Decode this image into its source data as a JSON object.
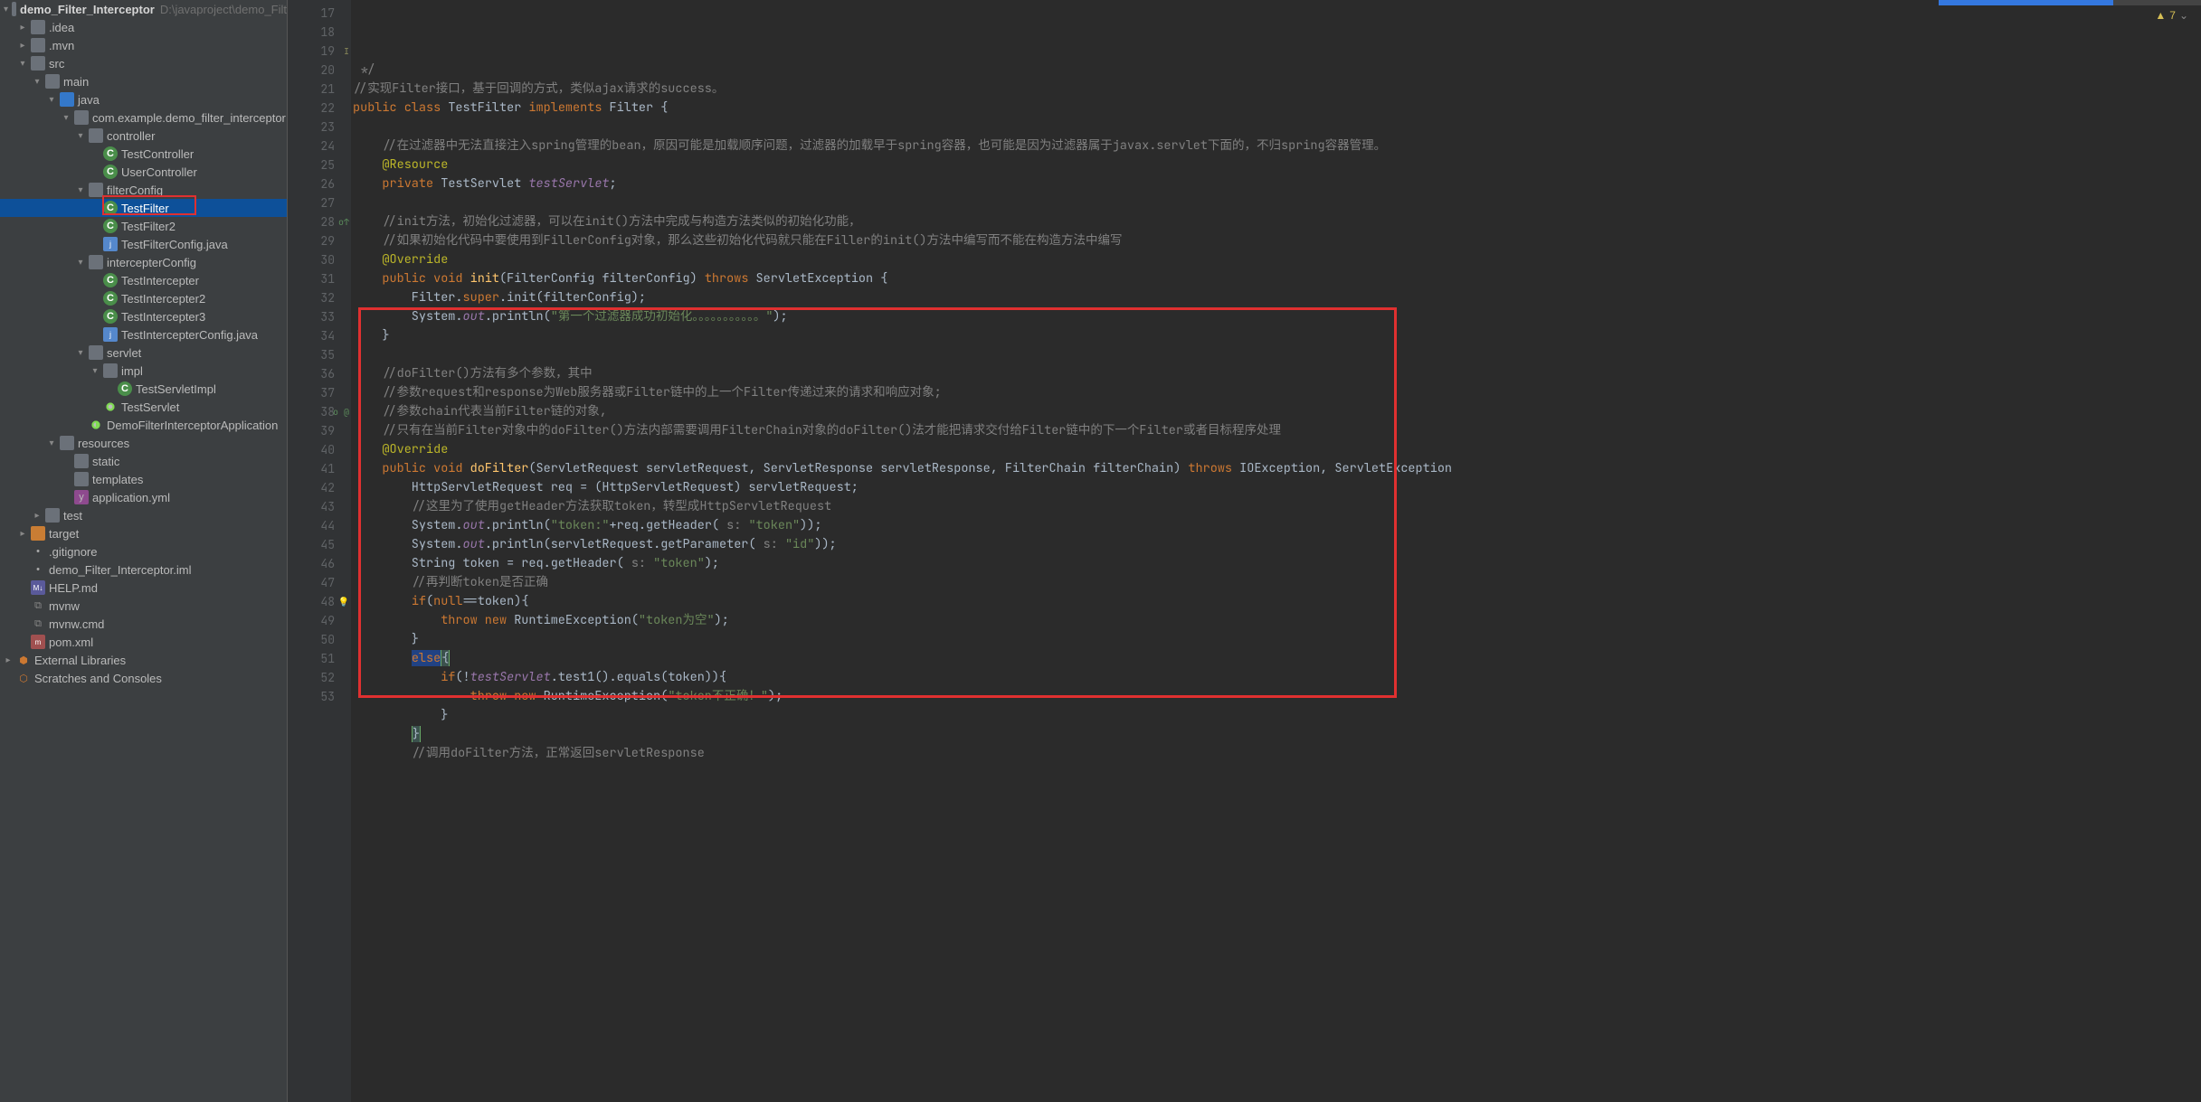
{
  "warnings": {
    "count": "7"
  },
  "project": {
    "name": "demo_Filter_Interceptor",
    "path": "D:\\javaproject\\demo_Filt"
  },
  "tree": [
    {
      "indent": 0,
      "arrow": "▾",
      "icon": "folder",
      "iconClass": "folder",
      "label": "demo_Filter_Interceptor",
      "bold": true,
      "extra": "D:\\javaproject\\demo_Filt"
    },
    {
      "indent": 1,
      "arrow": "▸",
      "icon": "folder",
      "iconClass": "folder",
      "label": ".idea"
    },
    {
      "indent": 1,
      "arrow": "▸",
      "icon": "folder",
      "iconClass": "folder",
      "label": ".mvn"
    },
    {
      "indent": 1,
      "arrow": "▾",
      "icon": "folder",
      "iconClass": "folder",
      "label": "src"
    },
    {
      "indent": 2,
      "arrow": "▾",
      "icon": "folder",
      "iconClass": "folder",
      "label": "main"
    },
    {
      "indent": 3,
      "arrow": "▾",
      "icon": "folder",
      "iconClass": "folder-blue",
      "label": "java"
    },
    {
      "indent": 4,
      "arrow": "▾",
      "icon": "folder",
      "iconClass": "folder",
      "label": "com.example.demo_filter_interceptor"
    },
    {
      "indent": 5,
      "arrow": "▾",
      "icon": "folder",
      "iconClass": "folder",
      "label": "controller"
    },
    {
      "indent": 6,
      "arrow": "",
      "icon": "C",
      "iconClass": "class",
      "label": "TestController"
    },
    {
      "indent": 6,
      "arrow": "",
      "icon": "C",
      "iconClass": "class",
      "label": "UserController"
    },
    {
      "indent": 5,
      "arrow": "▾",
      "icon": "folder",
      "iconClass": "folder",
      "label": "filterConfig"
    },
    {
      "indent": 6,
      "arrow": "",
      "icon": "C",
      "iconClass": "class",
      "label": "TestFilter",
      "selected": true,
      "boxed": true
    },
    {
      "indent": 6,
      "arrow": "",
      "icon": "C",
      "iconClass": "class",
      "label": "TestFilter2"
    },
    {
      "indent": 6,
      "arrow": "",
      "icon": "j",
      "iconClass": "config",
      "label": "TestFilterConfig.java"
    },
    {
      "indent": 5,
      "arrow": "▾",
      "icon": "folder",
      "iconClass": "folder",
      "label": "intercepterConfig"
    },
    {
      "indent": 6,
      "arrow": "",
      "icon": "C",
      "iconClass": "class",
      "label": "TestIntercepter"
    },
    {
      "indent": 6,
      "arrow": "",
      "icon": "C",
      "iconClass": "class",
      "label": "TestIntercepter2"
    },
    {
      "indent": 6,
      "arrow": "",
      "icon": "C",
      "iconClass": "class",
      "label": "TestIntercepter3"
    },
    {
      "indent": 6,
      "arrow": "",
      "icon": "j",
      "iconClass": "config",
      "label": "TestIntercepterConfig.java"
    },
    {
      "indent": 5,
      "arrow": "▾",
      "icon": "folder",
      "iconClass": "folder",
      "label": "servlet"
    },
    {
      "indent": 6,
      "arrow": "▾",
      "icon": "folder",
      "iconClass": "folder",
      "label": "impl"
    },
    {
      "indent": 7,
      "arrow": "",
      "icon": "C",
      "iconClass": "class",
      "label": "TestServletImpl"
    },
    {
      "indent": 6,
      "arrow": "",
      "icon": "●",
      "iconClass": "app",
      "label": "TestServlet"
    },
    {
      "indent": 5,
      "arrow": "",
      "icon": "◐",
      "iconClass": "app",
      "label": "DemoFilterInterceptorApplication"
    },
    {
      "indent": 3,
      "arrow": "▾",
      "icon": "folder",
      "iconClass": "folder",
      "label": "resources"
    },
    {
      "indent": 4,
      "arrow": "",
      "icon": "folder",
      "iconClass": "folder",
      "label": "static"
    },
    {
      "indent": 4,
      "arrow": "",
      "icon": "folder",
      "iconClass": "folder",
      "label": "templates"
    },
    {
      "indent": 4,
      "arrow": "",
      "icon": "y",
      "iconClass": "yml",
      "label": "application.yml"
    },
    {
      "indent": 2,
      "arrow": "▸",
      "icon": "folder",
      "iconClass": "folder",
      "label": "test"
    },
    {
      "indent": 1,
      "arrow": "▸",
      "icon": "folder",
      "iconClass": "folder-orange",
      "label": "target"
    },
    {
      "indent": 1,
      "arrow": "",
      "icon": "•",
      "iconClass": "txt",
      "label": ".gitignore"
    },
    {
      "indent": 1,
      "arrow": "",
      "icon": "•",
      "iconClass": "txt",
      "label": "demo_Filter_Interceptor.iml"
    },
    {
      "indent": 1,
      "arrow": "",
      "icon": "M↓",
      "iconClass": "md",
      "label": "HELP.md"
    },
    {
      "indent": 1,
      "arrow": "",
      "icon": "⧉",
      "iconClass": "cmd",
      "label": "mvnw"
    },
    {
      "indent": 1,
      "arrow": "",
      "icon": "⧉",
      "iconClass": "cmd",
      "label": "mvnw.cmd"
    },
    {
      "indent": 1,
      "arrow": "",
      "icon": "m",
      "iconClass": "xml",
      "label": "pom.xml"
    },
    {
      "indent": 0,
      "arrow": "▸",
      "icon": "⬢",
      "iconClass": "ext",
      "label": "External Libraries"
    },
    {
      "indent": 0,
      "arrow": "",
      "icon": "⬡",
      "iconClass": "scr",
      "label": "Scratches and Consoles"
    }
  ],
  "gutter": {
    "start": 17,
    "end": 53,
    "marks": {
      "19": "i",
      "28": "o↑",
      "38": "o↑ @",
      "48": "bulb"
    }
  },
  "codeLines": [
    {
      "n": 17,
      "html": " <span class='com'>*/</span>"
    },
    {
      "n": 18,
      "html": "<span class='com'>//实现Filter接口，基于回调的方式，类似ajax请求的success。</span>"
    },
    {
      "n": 19,
      "html": "<span class='kw'>public class </span><span class='typ'>TestFilter </span><span class='kw'>implements </span><span class='typ'>Filter </span>{"
    },
    {
      "n": 20,
      "html": ""
    },
    {
      "n": 21,
      "html": "    <span class='com'>//在过滤器中无法直接注入spring管理的bean，原因可能是加载顺序问题，过滤器的加载早于spring容器，也可能是因为过滤器属于javax.servlet下面的，不归spring容器管理。</span>"
    },
    {
      "n": 22,
      "html": "    <span class='ann'>@Resource</span>"
    },
    {
      "n": 23,
      "html": "    <span class='kw'>private </span><span class='typ'>TestServlet </span><span class='fld'>testServlet</span>;"
    },
    {
      "n": 24,
      "html": ""
    },
    {
      "n": 25,
      "html": "    <span class='com'>//init方法，初始化过滤器，可以在init()方法中完成与构造方法类似的初始化功能，</span>"
    },
    {
      "n": 26,
      "html": "    <span class='com'>//如果初始化代码中要使用到FillerConfig对象，那么这些初始化代码就只能在Filler的init()方法中编写而不能在构造方法中编写</span>"
    },
    {
      "n": 27,
      "html": "    <span class='ann'>@Override</span>"
    },
    {
      "n": 28,
      "html": "    <span class='kw'>public void </span><span class='met'>init</span>(FilterConfig filterConfig) <span class='kw'>throws </span>ServletException {"
    },
    {
      "n": 29,
      "html": "        Filter.<span class='kw'>super</span>.init(filterConfig);"
    },
    {
      "n": 30,
      "html": "        System.<span class='fld'>out</span>.println(<span class='str'>\"第一个过滤器成功初始化。。。。。。。。。。。\"</span>);"
    },
    {
      "n": 31,
      "html": "    }"
    },
    {
      "n": 32,
      "html": ""
    },
    {
      "n": 33,
      "html": "    <span class='com'>//doFilter()方法有多个参数，其中</span>"
    },
    {
      "n": 34,
      "html": "    <span class='com'>//参数request和response为Web服务器或Filter链中的上一个Filter传递过来的请求和响应对象;</span>"
    },
    {
      "n": 35,
      "html": "    <span class='com'>//参数chain代表当前Filter链的对象,</span>"
    },
    {
      "n": 36,
      "html": "    <span class='com'>//只有在当前Filter对象中的doFilter()方法内部需要调用FilterChain对象的doFilter()法才能把请求交付给Filter链中的下一个Filter或者目标程序处理</span>"
    },
    {
      "n": 37,
      "html": "    <span class='ann'>@Override</span>"
    },
    {
      "n": 38,
      "html": "    <span class='kw'>public void </span><span class='met'>doFilter</span>(ServletRequest servletRequest, ServletResponse servletResponse, FilterChain filterChain) <span class='kw'>throws </span>IOException, ServletException "
    },
    {
      "n": 39,
      "html": "        HttpServletRequest req = (HttpServletRequest) servletRequest;"
    },
    {
      "n": 40,
      "html": "        <span class='com'>//这里为了使用getHeader方法获取token，转型成HttpServletRequest</span>"
    },
    {
      "n": 41,
      "html": "        System.<span class='fld'>out</span>.println(<span class='str'>\"token:\"</span>+req.getHeader( <span class='com'>s:</span> <span class='str'>\"token\"</span>));"
    },
    {
      "n": 42,
      "html": "        System.<span class='fld'>out</span>.println(servletRequest.getParameter( <span class='com'>s:</span> <span class='str'>\"id\"</span>));"
    },
    {
      "n": 43,
      "html": "        String token = req.getHeader( <span class='com'>s:</span> <span class='str'>\"token\"</span>);"
    },
    {
      "n": 44,
      "html": "        <span class='com'>//再判断token是否正确</span>"
    },
    {
      "n": 45,
      "html": "        <span class='kw'>if</span>(<span class='kw'>null</span>==token){"
    },
    {
      "n": 46,
      "html": "            <span class='kw'>throw new </span>RuntimeException(<span class='str'>\"token为空\"</span>);"
    },
    {
      "n": 47,
      "html": "        }"
    },
    {
      "n": 48,
      "html": "        <span class='kw hl-else'>else</span><span class='hl-brace'>{</span>"
    },
    {
      "n": 49,
      "html": "            <span class='kw'>if</span>(!<span class='fld'>testServlet</span>.test1().equals(token)){"
    },
    {
      "n": 50,
      "html": "                <span class='kw'>throw new </span>RuntimeException(<span class='str'>\"token不正确！\"</span>);"
    },
    {
      "n": 51,
      "html": "            }"
    },
    {
      "n": 52,
      "html": "        <span class='hl-brace'>}</span>"
    },
    {
      "n": 53,
      "html": "        <span class='com'>//调用doFilter方法，正常返回servletResponse</span>"
    }
  ]
}
